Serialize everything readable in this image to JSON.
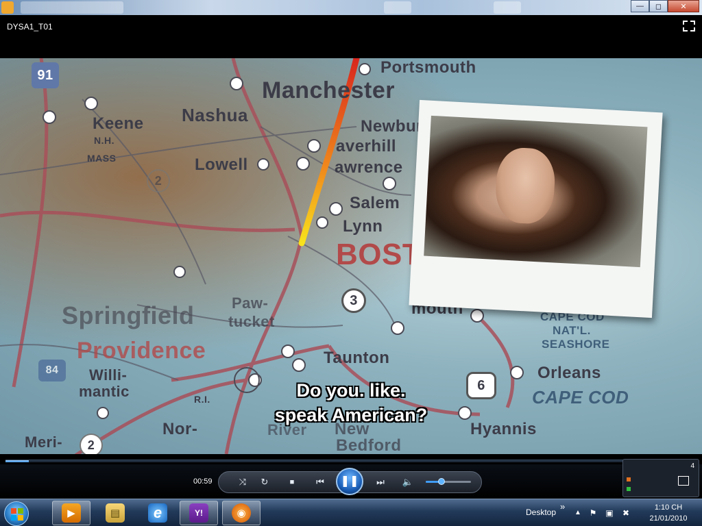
{
  "window": {
    "title": "DYSA1_T01",
    "controls": {
      "minimize": "—",
      "maximize": "◻",
      "close": "✕"
    }
  },
  "video": {
    "subtitle_line1": "Do you. like.",
    "subtitle_line2": "speak American?",
    "map_labels": {
      "portsmouth": "Portsmouth",
      "manchester": "Manchester",
      "nashua": "Nashua",
      "keene": "Keene",
      "nh": "N.H.",
      "mass": "MASS",
      "lowell": "Lowell",
      "newbur": "Newbur",
      "haverhill": "averhill",
      "lawrence": "awrence",
      "salem": "Salem",
      "lynn": "Lynn",
      "boston": "BOSTO",
      "plymouth": "mouth",
      "springfield": "Springfield",
      "providence": "Providence",
      "pawtucket_1": "Paw-",
      "pawtucket_2": "tucket",
      "willimantic_1": "Willi-",
      "willimantic_2": "mantic",
      "taunton": "Taunton",
      "cape_cod_seashore_1": "CAPE COD",
      "cape_cod_seashore_2": "NAT'L.",
      "cape_cod_seashore_3": "SEASHORE",
      "orleans": "Orleans",
      "cape_cod": "CAPE COD",
      "hyannis": "Hyannis",
      "new": "New",
      "bedford": "Bedford",
      "river": "River",
      "norwich": "Nor-",
      "meri": "Meri-",
      "ri": "R.I.",
      "route_91": "91",
      "route_3": "3",
      "route_6": "6",
      "route_2": "2",
      "route_2b": "2",
      "route_84": "84"
    }
  },
  "playback": {
    "elapsed": "00:59",
    "progress_fraction": 0.034,
    "volume_fraction": 0.35,
    "buttons": {
      "shuffle": "⤨",
      "repeat": "↻",
      "stop": "■",
      "previous": "⏮",
      "play_pause": "❚❚",
      "next": "⏭",
      "mute": "🔈"
    },
    "mini_count": "4"
  },
  "taskbar": {
    "tray_label": "Desktop",
    "tray_chevron": "»",
    "clock_time": "1:10 CH",
    "clock_date": "21/01/2010",
    "apps": [
      {
        "name": "windows-media-player",
        "glyph": "▶"
      },
      {
        "name": "windows-explorer",
        "glyph": "▤"
      },
      {
        "name": "internet-explorer",
        "glyph": "e"
      },
      {
        "name": "yahoo-messenger",
        "glyph": "Y!"
      },
      {
        "name": "firefox",
        "glyph": "◉"
      }
    ]
  },
  "colors": {
    "accent": "#3a8fe0",
    "taskbar": "#223a5a",
    "title_red": "#c74a31"
  }
}
